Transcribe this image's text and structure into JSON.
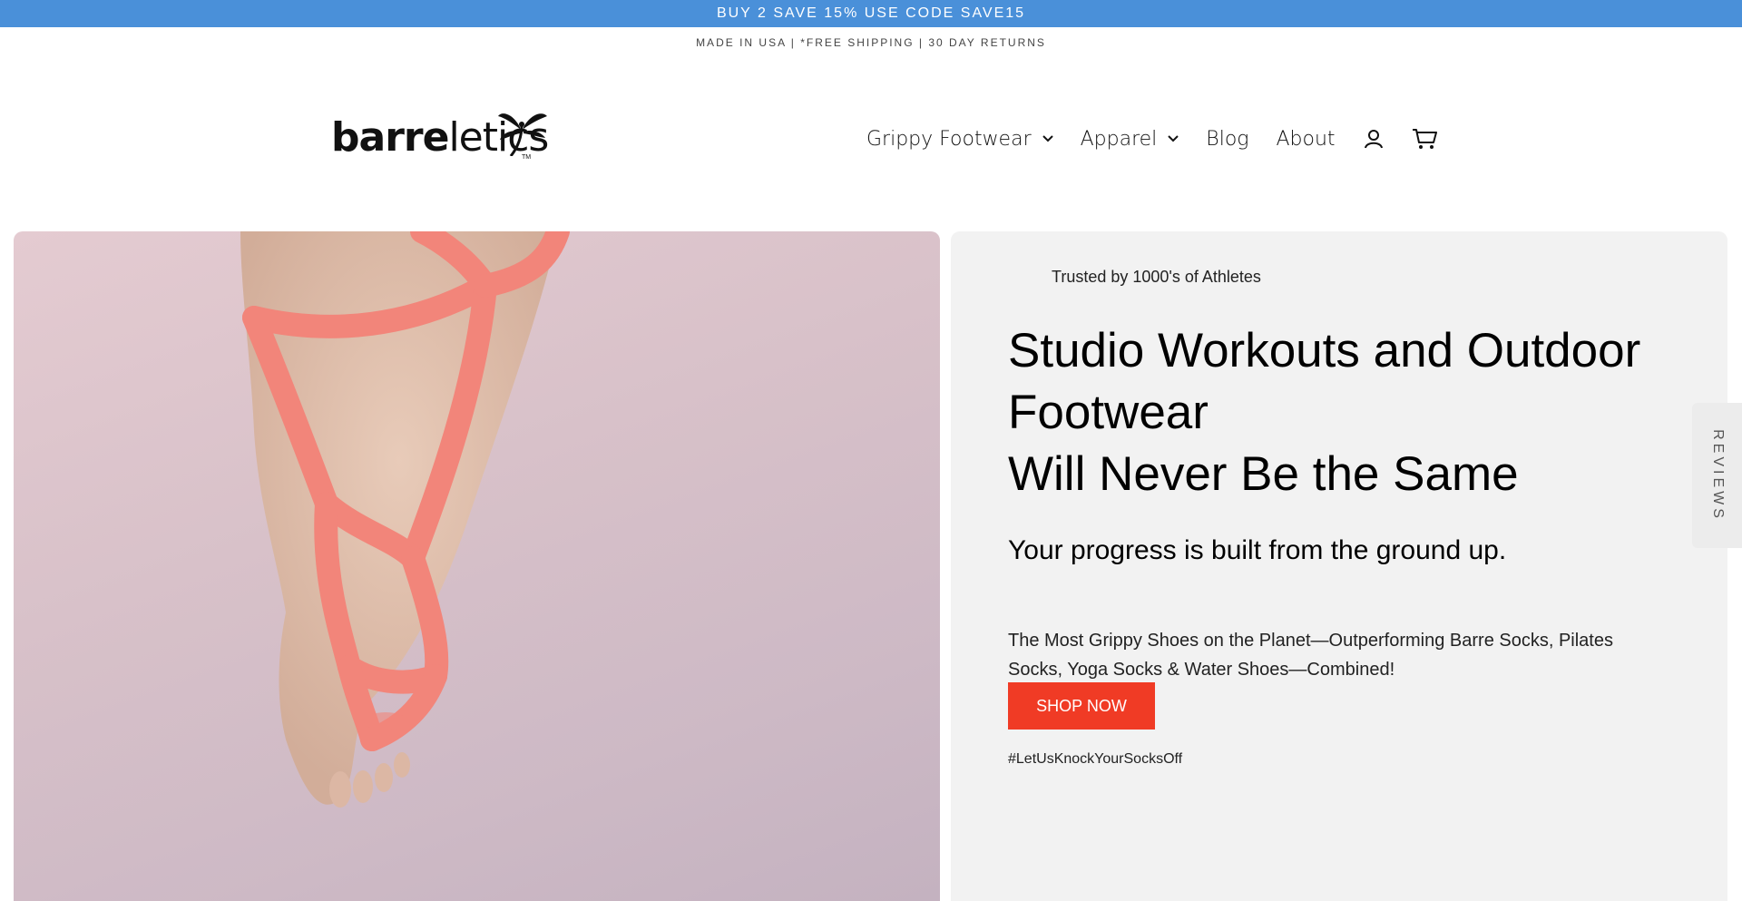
{
  "promo": {
    "text": "BUY 2 SAVE 15% USE CODE SAVE15"
  },
  "subbar": {
    "text": "MADE IN USA | *FREE SHIPPING | 30 DAY RETURNS"
  },
  "header": {
    "logo": {
      "part1": "barre",
      "part2": "letics",
      "tm": "TM"
    },
    "nav": [
      {
        "label": "Grippy Footwear",
        "icon": "chevron-down-icon"
      },
      {
        "label": "Apparel",
        "icon": "chevron-down-icon"
      },
      {
        "label": "Blog"
      },
      {
        "label": "About"
      }
    ],
    "icons": {
      "account": "user-icon",
      "cart": "cart-icon"
    }
  },
  "hero": {
    "trusted": "Trusted by 1000's of Athletes",
    "headline": {
      "line1": "Studio Workouts and Outdoor",
      "line2": "Footwear",
      "line3": "Will Never Be the Same"
    },
    "subheadline": "Your progress is built from the ground up.",
    "description": "The Most Grippy Shoes on the Planet—Outperforming Barre Socks, Pilates Socks, Yoga Socks & Water Shoes—Combined!",
    "cta": "SHOP NOW",
    "hashtag": "#LetUsKnockYourSocksOff"
  },
  "reviews_tab": {
    "label": "REVIEWS"
  },
  "colors": {
    "promo_bg": "#4a90d9",
    "cta_bg": "#f03b25",
    "panel_bg": "#f2f2f2",
    "footwear_pink": "#f2857a"
  }
}
